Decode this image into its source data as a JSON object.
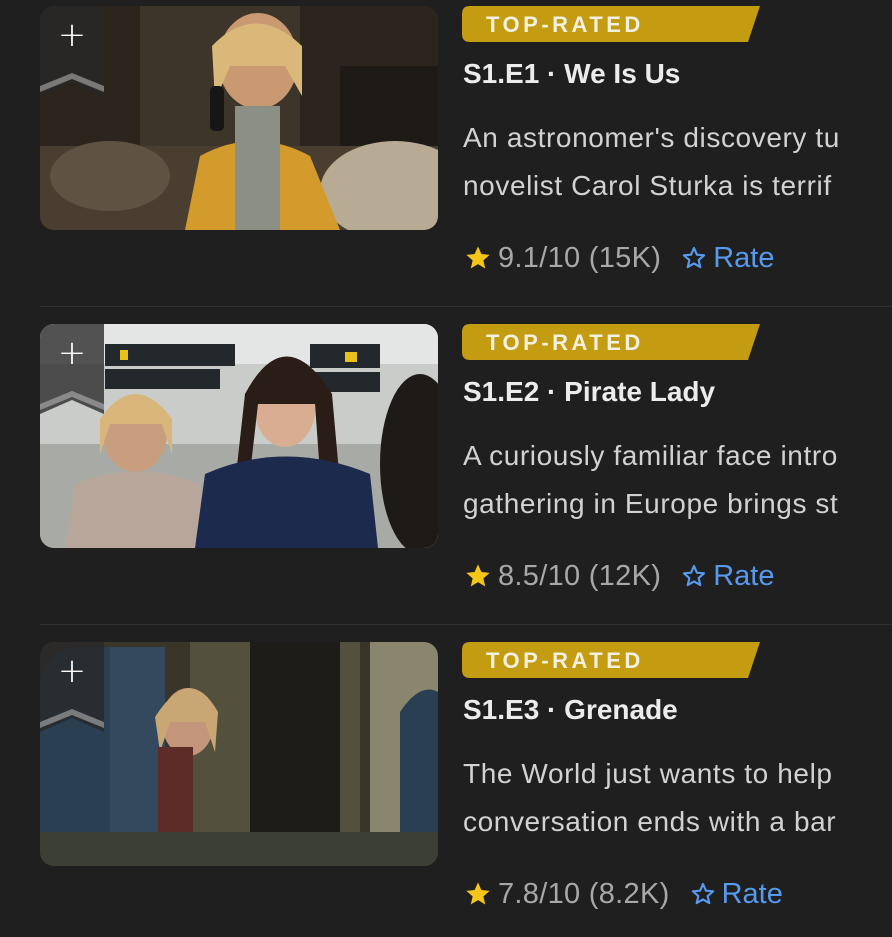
{
  "colors": {
    "background": "#1f1f1f",
    "badge": "#c49c12",
    "star": "#f5c518",
    "rate": "#5799ef"
  },
  "episodes": [
    {
      "badge": "TOP-RATED",
      "title": "S1.E1 · We Is Us",
      "description": [
        "An astronomer's discovery tu",
        "novelist Carol Sturka is terrif"
      ],
      "score": "9.1/10 (15K)",
      "rate_label": "Rate",
      "add_label": "+"
    },
    {
      "badge": "TOP-RATED",
      "title": "S1.E2 · Pirate Lady",
      "description": [
        "A curiously familiar face intro",
        "gathering in Europe brings st"
      ],
      "score": "8.5/10 (12K)",
      "rate_label": "Rate",
      "add_label": "+"
    },
    {
      "badge": "TOP-RATED",
      "title": "S1.E3 · Grenade",
      "description": [
        "The World just wants to help",
        "conversation ends with a bar"
      ],
      "score": "7.8/10 (8.2K)",
      "rate_label": "Rate",
      "add_label": "+"
    }
  ]
}
